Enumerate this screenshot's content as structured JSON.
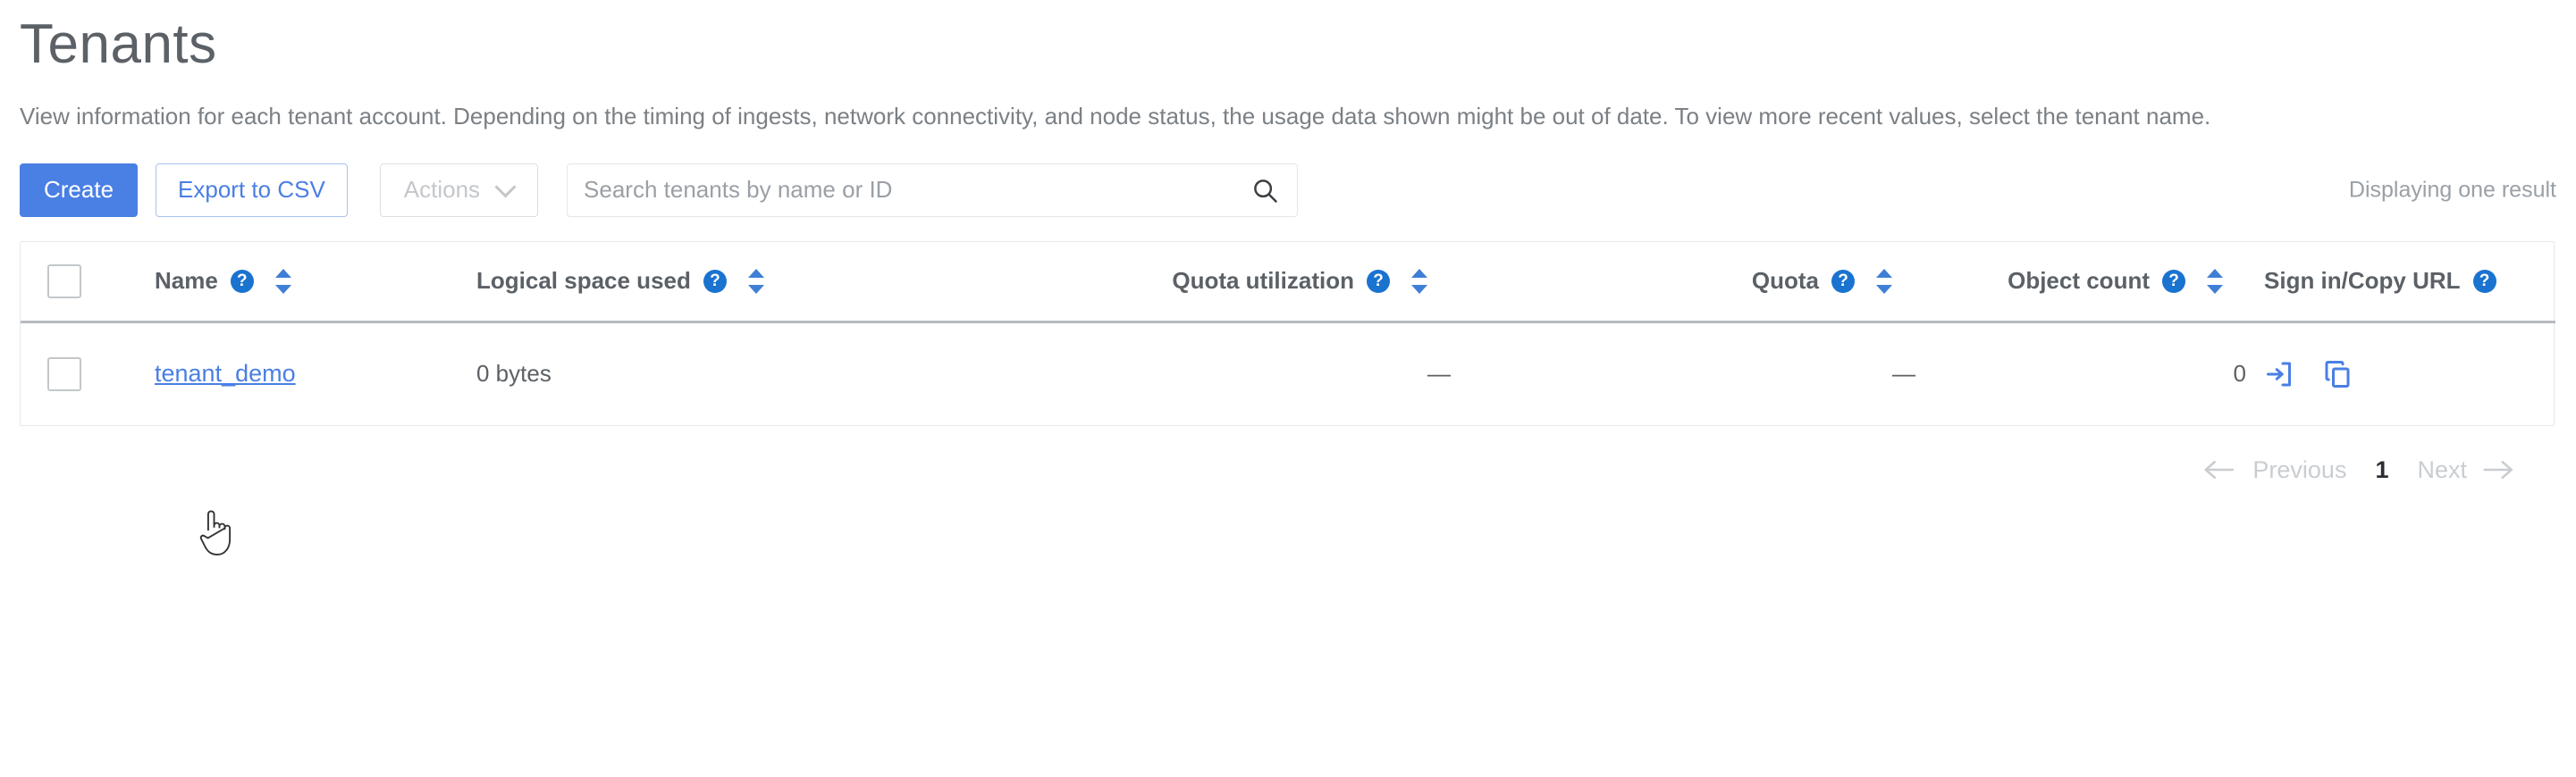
{
  "page": {
    "title": "Tenants",
    "description": "View information for each tenant account. Depending on the timing of ingests, network connectivity, and node status, the usage data shown might be out of date. To view more recent values, select the tenant name."
  },
  "toolbar": {
    "create_label": "Create",
    "export_label": "Export to CSV",
    "actions_label": "Actions",
    "actions_disabled": true,
    "search_placeholder": "Search tenants by name or ID",
    "search_value": "",
    "result_count_text": "Displaying one result"
  },
  "table": {
    "columns": [
      {
        "id": "select",
        "label": "",
        "help": false,
        "sortable": false,
        "align": "left"
      },
      {
        "id": "name",
        "label": "Name",
        "help": true,
        "sortable": true,
        "align": "left"
      },
      {
        "id": "logical_space_used",
        "label": "Logical space used",
        "help": true,
        "sortable": true,
        "align": "left"
      },
      {
        "id": "quota_utilization",
        "label": "Quota utilization",
        "help": true,
        "sortable": true,
        "align": "right"
      },
      {
        "id": "quota",
        "label": "Quota",
        "help": true,
        "sortable": true,
        "align": "right"
      },
      {
        "id": "object_count",
        "label": "Object count",
        "help": true,
        "sortable": true,
        "align": "right"
      },
      {
        "id": "sign_in_copy_url",
        "label": "Sign in/Copy URL",
        "help": true,
        "sortable": false,
        "align": "left"
      }
    ],
    "rows": [
      {
        "selected": false,
        "name": "tenant_demo",
        "logical_space_used": "0 bytes",
        "quota_utilization": "—",
        "quota": "—",
        "object_count": "0",
        "actions": [
          "sign-in-icon",
          "copy-url-icon"
        ]
      }
    ]
  },
  "pagination": {
    "previous_label": "Previous",
    "current_page": "1",
    "next_label": "Next",
    "previous_enabled": false,
    "next_enabled": false
  },
  "icons": {
    "help": "?",
    "search": "search-icon",
    "sign_in": "sign-in-icon",
    "copy": "copy-url-icon",
    "chevron_down": "chevron-down-icon",
    "arrow_left": "arrow-left-icon",
    "arrow_right": "arrow-right-icon"
  },
  "colors": {
    "primary_blue": "#4a7fe3",
    "link_blue": "#4a7fe3",
    "help_icon_blue": "#1a73cf",
    "sort_blue": "#3f7fd6",
    "text_gray": "#5b6166",
    "muted_gray": "#9aa0a6",
    "border_gray": "#e6e8ea"
  }
}
